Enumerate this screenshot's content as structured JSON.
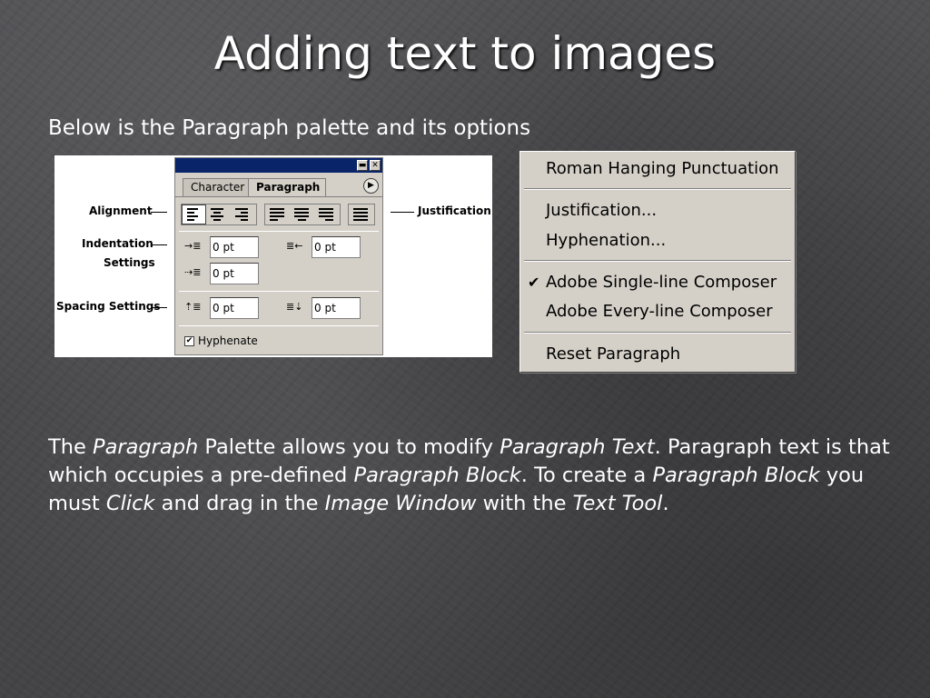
{
  "slide": {
    "title": "Adding text to images",
    "intro": "Below is the Paragraph palette and its options"
  },
  "palette": {
    "callouts": {
      "alignment": "Alignment",
      "indentation_1": "Indentation",
      "indentation_2": "Settings",
      "spacing": "Spacing Settings",
      "justification": "Justification"
    },
    "title_buttons": {
      "minimize": "▬",
      "close": "✕"
    },
    "tabs": {
      "character": "Character",
      "paragraph": "Paragraph"
    },
    "menu_button": "▶",
    "fields": {
      "left_indent": "0 pt",
      "right_indent": "0 pt",
      "first_line_indent": "0 pt",
      "space_before": "0 pt",
      "space_after": "0 pt"
    },
    "hyphenate_label": "Hyphenate",
    "hyphenate_checked": "✔"
  },
  "context_menu": {
    "items": [
      "Roman Hanging Punctuation",
      "Justification...",
      "Hyphenation...",
      "Adobe Single-line Composer",
      "Adobe Every-line Composer",
      "Reset Paragraph"
    ],
    "check_mark": "✔"
  },
  "body": {
    "p1": "The ",
    "p2": "Paragraph",
    "p3": " Palette allows you to modify ",
    "p4": "Paragraph Text",
    "p5": ".  Paragraph text is that which occupies a pre-defined ",
    "p6": "Paragraph Block",
    "p7": ".  To create a ",
    "p8": "Paragraph Block",
    "p9": " you must ",
    "p10": "Click",
    "p11": " and drag in the ",
    "p12": "Image Window",
    "p13": " with the ",
    "p14": "Text Tool",
    "p15": "."
  }
}
